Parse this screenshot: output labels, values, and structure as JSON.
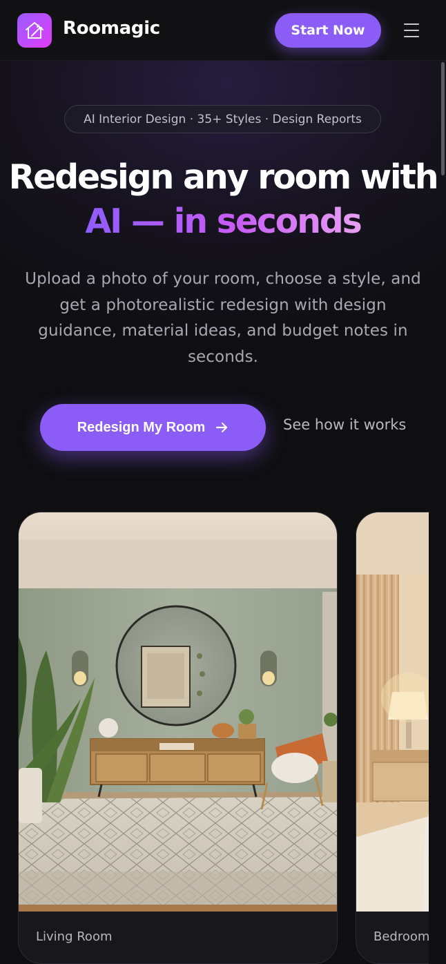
{
  "header": {
    "brand": "Roomagic",
    "start_label": "Start Now",
    "menu_icon": "hamburger-menu-icon",
    "logo_icon": "house-magic-wand-icon"
  },
  "hero": {
    "pill": "AI Interior Design · 35+ Styles · Design Reports",
    "headline_line1": "Redesign any room with",
    "headline_line2": "AI — in seconds",
    "subtitle": "Upload a photo of your room, choose a style, and get a photorealistic redesign with design guidance, material ideas, and budget notes in seconds.",
    "cta_label": "Redesign My Room",
    "cta_icon": "arrow-right-icon",
    "secondary_link": "See how it works"
  },
  "gallery": {
    "cards": [
      {
        "label": "Living Room"
      },
      {
        "label": "Bedroom"
      }
    ]
  },
  "colors": {
    "accent": "#8b5cf6",
    "background": "#0f0f12",
    "gradient_start": "#8f5cff",
    "gradient_end": "#e7a0f2"
  }
}
